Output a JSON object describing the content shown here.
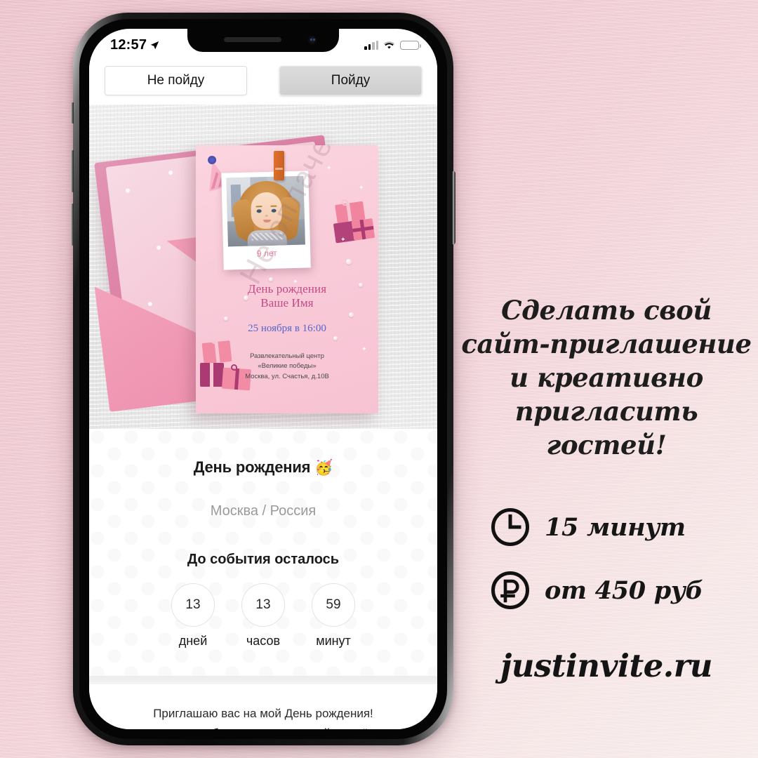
{
  "phone": {
    "status_bar": {
      "time": "12:57",
      "location_icon": "location-arrow-icon",
      "signal_icon": "cellular-signal-icon",
      "wifi_icon": "wifi-icon",
      "battery_icon": "battery-icon",
      "battery_color": "#fdc400"
    },
    "rsvp": {
      "decline_label": "Не пойду",
      "accept_label": "Пойду"
    },
    "card": {
      "watermark": "Не оплачено",
      "age": "9 лет",
      "title_line1": "День рождения",
      "title_line2": "Ваше Имя",
      "date": "25 ноября в 16:00",
      "venue_line1": "Развлекательный центр",
      "venue_line2": "«Великие победы»",
      "venue_line3": "Москва, ул. Счастья, д.10В",
      "title_color": "#c44a85",
      "date_color": "#5566c9",
      "age_color": "#ef7f9a"
    },
    "content": {
      "event_title": "День рождения",
      "event_emoji": "🥳",
      "event_place": "Москва / Россия",
      "countdown_label": "До события осталось",
      "countdown": [
        {
          "value": "13",
          "unit": "дней"
        },
        {
          "value": "13",
          "unit": "часов"
        },
        {
          "value": "59",
          "unit": "минут"
        }
      ]
    },
    "footer": {
      "line1": "Приглашаю вас на мой День рождения!",
      "line2": "С вами праздник будет ярче и веселей, а моё сердце счастливее!"
    }
  },
  "promo": {
    "headline_line1": "Сделать свой",
    "headline_line2": "сайт-приглашение",
    "headline_line3": "и креативно",
    "headline_line4": "пригласить гостей!",
    "features": [
      {
        "icon": "clock-icon",
        "text": "15 минут"
      },
      {
        "icon": "ruble-icon",
        "text": "от 450 руб"
      }
    ],
    "site": "justinvite.ru"
  },
  "colors": {
    "background_pink": "#eec6ce",
    "envelope_dark": "#d4638f",
    "envelope_light": "#f09cb6",
    "card_pink": "#f9cbd9"
  }
}
